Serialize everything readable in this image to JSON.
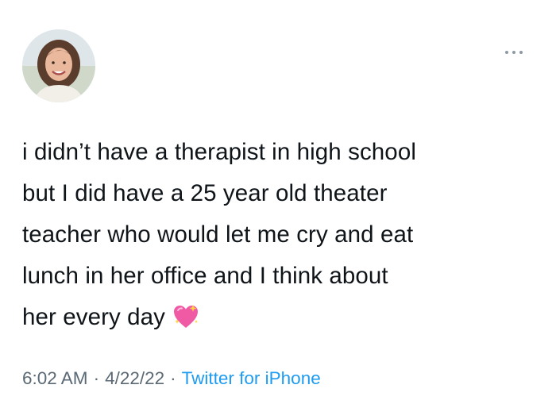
{
  "tweet": {
    "text_lines": [
      "i didn’t have a therapist in high school",
      "but I did have a 25 year old theater",
      "teacher who would let me cry and eat",
      "lunch in her office and I think about",
      "her every day"
    ],
    "emoji_icon": "sparkling-heart-icon",
    "more_icon": "more-options-icon",
    "timestamp_time": "6:02 AM",
    "separator": "·",
    "timestamp_date": "4/22/22",
    "source": "Twitter for iPhone"
  },
  "colors": {
    "text": "#0f1419",
    "meta": "#5b6975",
    "link": "#1d9bf0",
    "heart": "#f05aa5"
  }
}
